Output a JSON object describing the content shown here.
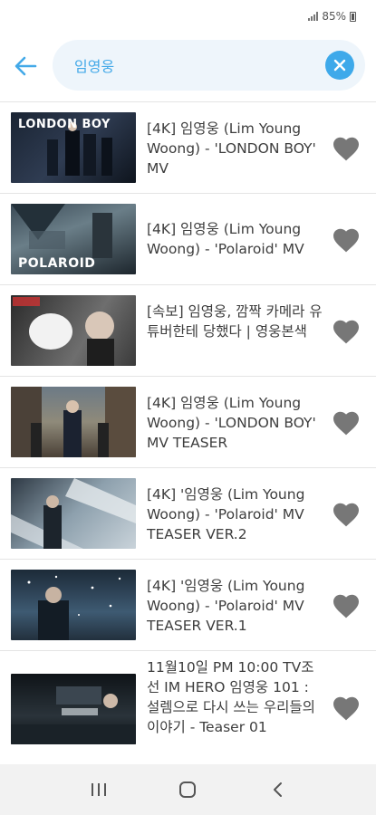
{
  "status": {
    "battery": "85%"
  },
  "search": {
    "query": "임영웅"
  },
  "results": [
    {
      "title": "[4K] 임영웅 (Lim Young Woong) - 'LONDON BOY' MV",
      "thumb_text": "LONDON BOY"
    },
    {
      "title": "[4K] 임영웅 (Lim Young Woong) - 'Polaroid' MV",
      "thumb_text": "POLAROID"
    },
    {
      "title": "[속보] 임영웅, 깜짝 카메라 유튜버한테 당했다 | 영웅본색",
      "thumb_text": ""
    },
    {
      "title": "[4K] 임영웅 (Lim Young Woong) - 'LONDON BOY' MV TEASER",
      "thumb_text": ""
    },
    {
      "title": "[4K] '임영웅 (Lim Young Woong) - 'Polaroid' MV TEASER VER.2",
      "thumb_text": ""
    },
    {
      "title": "[4K] '임영웅 (Lim Young Woong) - 'Polaroid' MV TEASER VER.1",
      "thumb_text": ""
    },
    {
      "title": "11월10일 PM 10:00 TV조선 IM HERO 임영웅 101 : 설렘으로 다시 쓰는 우리들의 이야기 - Teaser 01",
      "thumb_text": ""
    }
  ],
  "icons": {
    "back": "arrow-left-icon",
    "clear": "close-icon",
    "favorite": "heart-icon",
    "nav_recent": "recent-apps-icon",
    "nav_home": "home-icon",
    "nav_back": "chevron-left-icon"
  },
  "colors": {
    "accent": "#3ea9ea",
    "heart": "#777777",
    "search_bg": "#eef5fb"
  }
}
